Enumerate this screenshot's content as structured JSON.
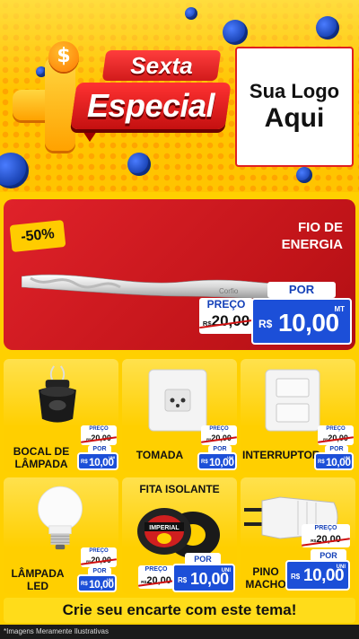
{
  "header": {
    "ribbon_top": "Sexta",
    "ribbon_bottom": "Especial",
    "dollar_symbol": "$",
    "logo_line1": "Sua Logo",
    "logo_line2": "Aqui"
  },
  "feature": {
    "discount": "-50%",
    "title": "FIO DE ENERGIA",
    "cable_brand": "Corfio",
    "old_label": "PREÇO",
    "old_currency": "R$",
    "old_value": "20,00",
    "por_label": "POR",
    "currency": "R$",
    "price": "10,00",
    "unit": "MT"
  },
  "products": [
    {
      "name": "BOCAL DE LÂMPADA",
      "old_label": "PREÇO",
      "old_currency": "R$",
      "old_value": "20,00",
      "por_label": "POR",
      "currency": "R$",
      "price": "10,00",
      "unit": "UNI"
    },
    {
      "name": "TOMADA",
      "old_label": "PREÇO",
      "old_currency": "R$",
      "old_value": "20,00",
      "por_label": "POR",
      "currency": "R$",
      "price": "10,00",
      "unit": "UNI"
    },
    {
      "name": "INTERRUPTOR",
      "old_label": "PREÇO",
      "old_currency": "R$",
      "old_value": "20,00",
      "por_label": "POR",
      "currency": "R$",
      "price": "10,00",
      "unit": "UNI"
    },
    {
      "name": "LÂMPADA LED",
      "old_label": "PREÇO",
      "old_currency": "R$",
      "old_value": "20,00",
      "por_label": "POR",
      "currency": "R$",
      "price": "10,00",
      "unit": "UNI"
    },
    {
      "name": "FITA ISOLANTE",
      "tape_brand": "IMPERIAL",
      "old_label": "PREÇO",
      "old_currency": "R$",
      "old_value": "20,00",
      "por_label": "POR",
      "currency": "R$",
      "price": "10,00",
      "unit": "UNI"
    },
    {
      "name": "PINO MACHO",
      "old_label": "PREÇO",
      "old_currency": "R$",
      "old_value": "20,00",
      "por_label": "POR",
      "currency": "R$",
      "price": "10,00",
      "unit": "UNI"
    }
  ],
  "cta": "Crie seu encarte com este tema!",
  "footer": "*Imagens Meramente Ilustrativas",
  "colors": {
    "yellow": "#ffd000",
    "red": "#d11b1b",
    "blue": "#1c4fd8"
  },
  "icons": [
    "dollar-coin-icon",
    "plus-icon",
    "blue-coin-icon"
  ]
}
